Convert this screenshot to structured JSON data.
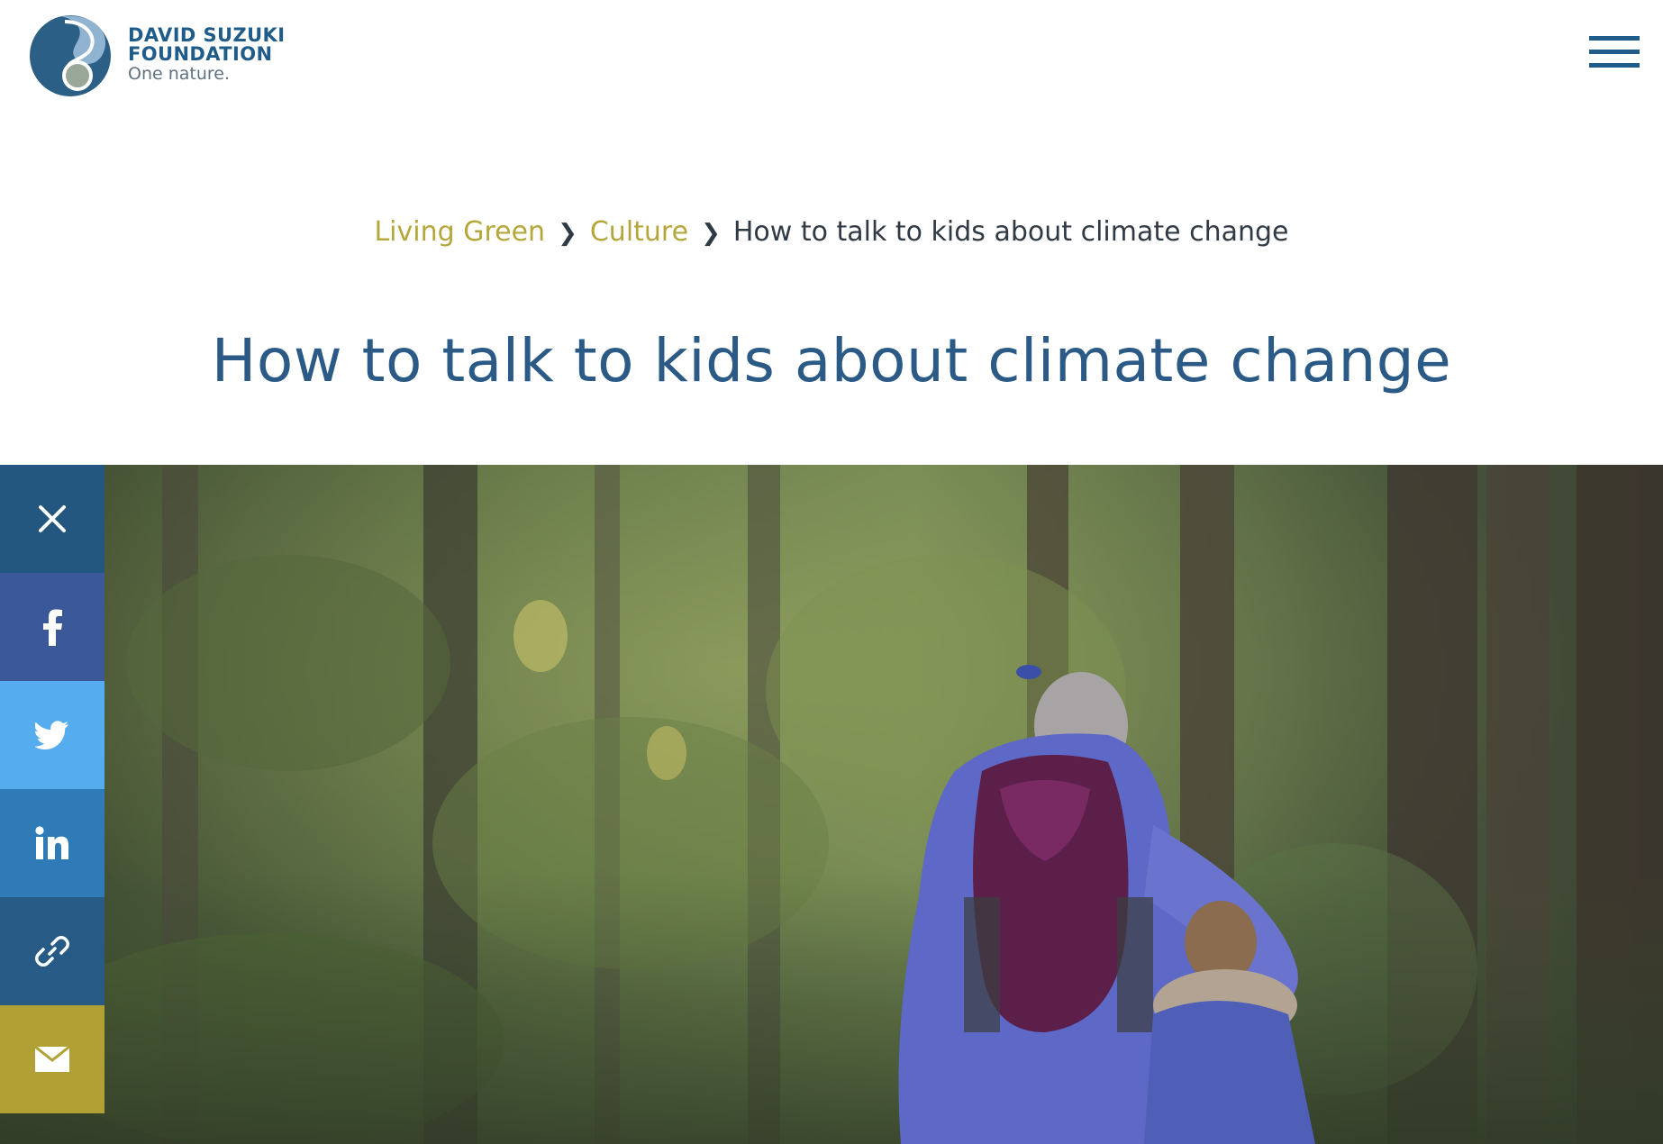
{
  "header": {
    "logo": {
      "line1": "DAVID SUZUKI",
      "line2": "FOUNDATION",
      "line3": "One nature."
    },
    "menu_icon": "hamburger-menu-icon"
  },
  "breadcrumb": {
    "items": [
      {
        "label": "Living Green"
      },
      {
        "label": "Culture"
      }
    ],
    "current": "How to talk to kids about climate change",
    "separator_icon": "chevron-right-icon"
  },
  "page_title": "How to talk to kids about climate change",
  "share_bar": {
    "buttons": [
      {
        "name": "close",
        "icon": "close-icon",
        "color": "#24577f"
      },
      {
        "name": "facebook",
        "icon": "facebook-icon",
        "color": "#3b5998"
      },
      {
        "name": "twitter",
        "icon": "twitter-icon",
        "color": "#55acee"
      },
      {
        "name": "linkedin",
        "icon": "linkedin-icon",
        "color": "#2f7bb8"
      },
      {
        "name": "copy-link",
        "icon": "link-icon",
        "color": "#275b86"
      },
      {
        "name": "email",
        "icon": "email-icon",
        "color": "#b1a134"
      }
    ]
  },
  "colors": {
    "brand_blue": "#1f5c8a",
    "title_blue": "#2a5a85",
    "breadcrumb_gold": "#b5a73c",
    "text_dark": "#2f3a45"
  }
}
